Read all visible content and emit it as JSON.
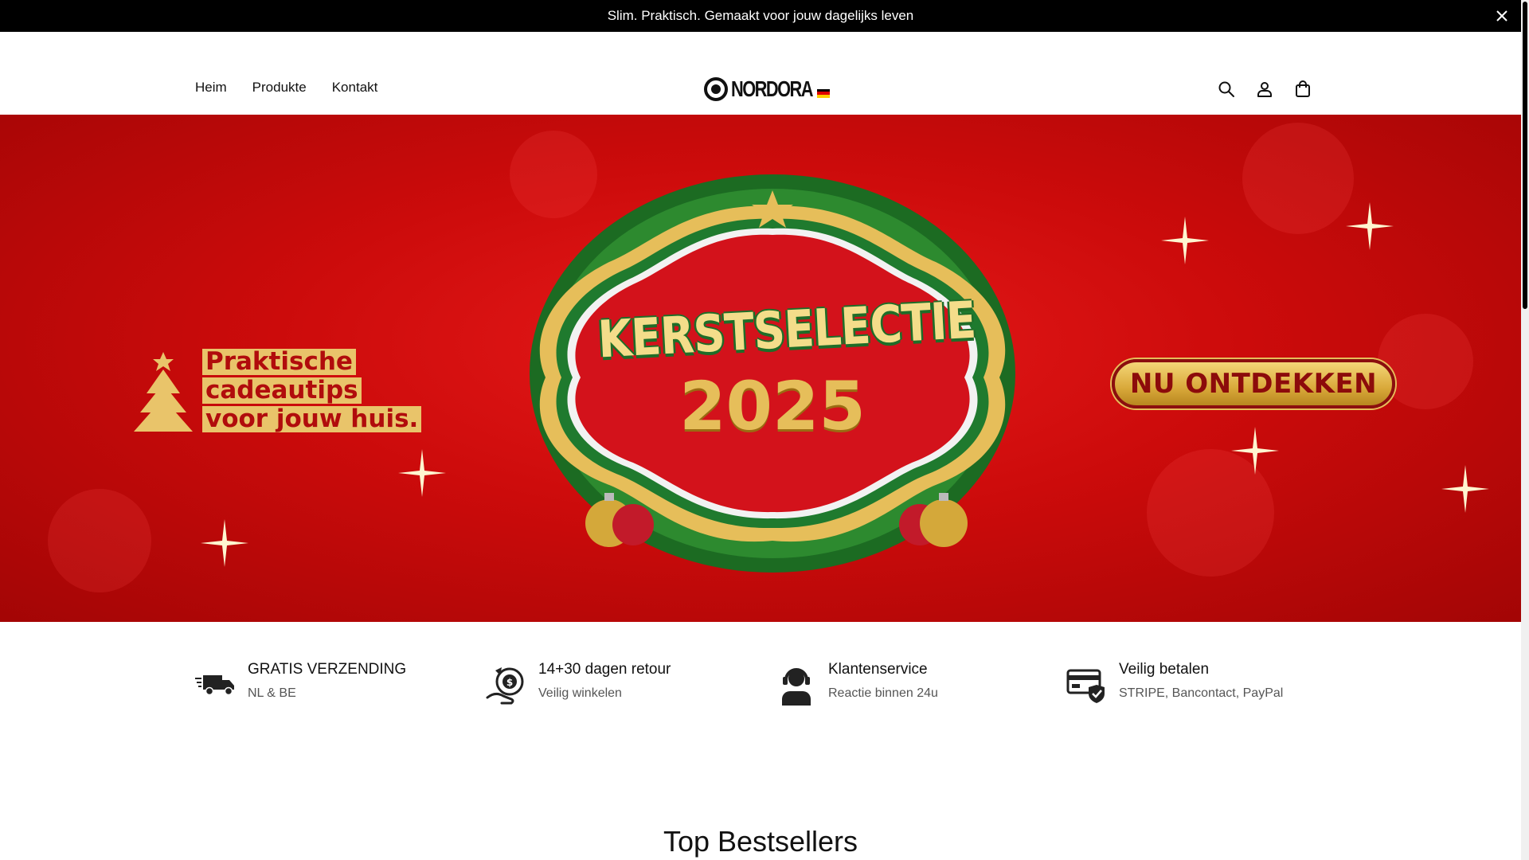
{
  "announcement": {
    "text": "Slim. Praktisch. Gemaakt voor jouw dagelijks leven",
    "close_icon": "close-icon"
  },
  "nav": {
    "items": [
      {
        "label": "Heim"
      },
      {
        "label": "Produkte"
      },
      {
        "label": "Kontakt"
      }
    ]
  },
  "logo": {
    "text": "NORDORA"
  },
  "header_icons": [
    "search-icon",
    "user-icon",
    "shopping-bag-icon"
  ],
  "hero": {
    "tagline": [
      "Praktische",
      "cadeautips",
      "voor jouw huis."
    ],
    "badge_title": "KERSTSELECTIE",
    "badge_year": "2025",
    "cta_label": "NU ONTDEKKEN",
    "colors": {
      "background": "#cc0b0b",
      "gold": "#e9c46a",
      "green": "#1f7a2e"
    }
  },
  "features": [
    {
      "icon": "delivery-truck-icon",
      "title": "GRATIS VERZENDING",
      "subtitle": "NL & BE"
    },
    {
      "icon": "money-return-icon",
      "title": "14+30 dagen retour",
      "subtitle": "Veilig winkelen"
    },
    {
      "icon": "customer-service-icon",
      "title": "Klantenservice",
      "subtitle": "Reactie binnen 24u"
    },
    {
      "icon": "secure-card-icon",
      "title": "Veilig betalen",
      "subtitle": "STRIPE, Bancontact, PayPal"
    }
  ],
  "section": {
    "title": "Top Bestsellers"
  }
}
